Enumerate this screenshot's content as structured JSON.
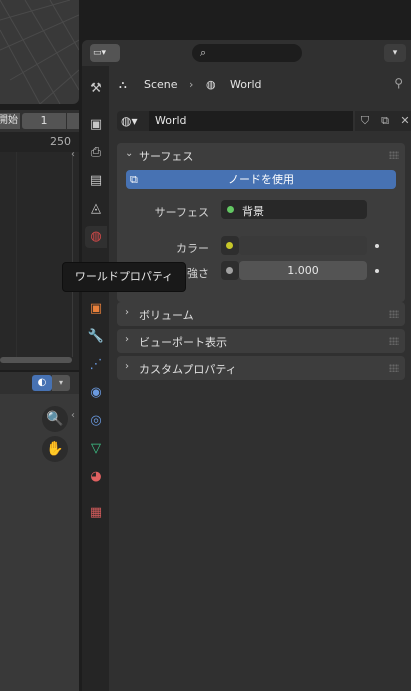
{
  "timeline": {
    "frame_start_label": "開始",
    "frame_start_value": "1",
    "frame_end_value": "250"
  },
  "properties": {
    "search_placeholder": "",
    "breadcrumb": {
      "scene": "Scene",
      "world": "World"
    },
    "world_selector": {
      "name": "World"
    },
    "surface_panel": {
      "title": "サーフェス",
      "use_nodes_label": "ノードを使用",
      "surface_label": "サーフェス",
      "surface_value": "背景",
      "color_label": "カラー",
      "strength_label": "強さ",
      "strength_value": "1.000"
    },
    "collapsed_panels": [
      {
        "title": "ボリューム"
      },
      {
        "title": "ビューポート表示"
      },
      {
        "title": "カスタムプロパティ"
      }
    ],
    "tabs": [
      "tool-icon",
      "render-icon",
      "output-icon",
      "view-layer-icon",
      "scene-icon",
      "world-icon",
      "object-icon",
      "modifier-icon",
      "particles-icon",
      "physics-icon",
      "constraints-icon",
      "object-data-icon",
      "material-icon",
      "texture-icon"
    ]
  },
  "tooltip": {
    "text": "ワールドプロパティ"
  },
  "colors": {
    "accent_blue": "#4772b3",
    "socket_green": "#63c763",
    "socket_yellow": "#c7c729",
    "socket_grey": "#a1a1a1"
  }
}
